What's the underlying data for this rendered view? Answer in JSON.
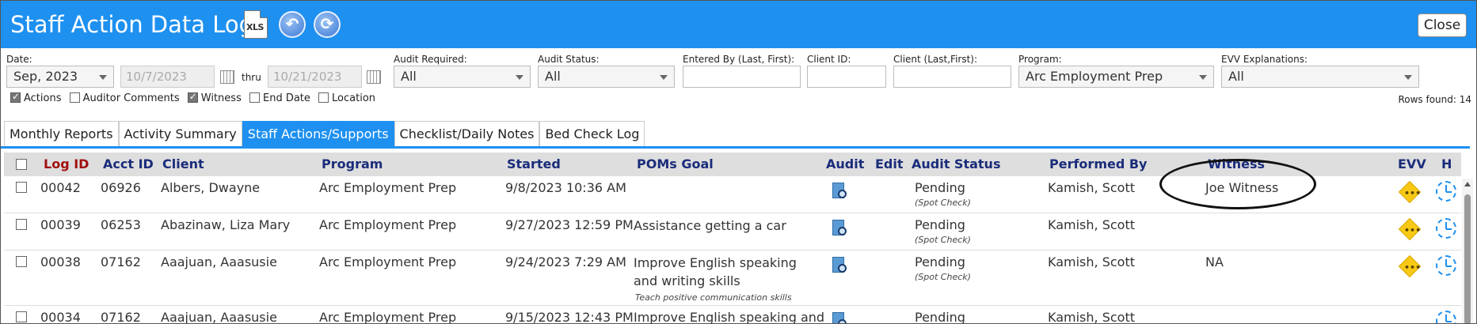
{
  "window": {
    "title": "Staff Action Data Log",
    "xls_label": "XLS",
    "close_label": "Close"
  },
  "filters": {
    "date_label": "Date:",
    "date_value": "Sep, 2023",
    "from_date": "10/7/2023",
    "thru_label": "thru",
    "to_date": "10/21/2023",
    "audit_required_label": "Audit Required:",
    "audit_required_value": "All",
    "audit_status_label": "Audit Status:",
    "audit_status_value": "All",
    "entered_by_label": "Entered By (Last, First):",
    "client_id_label": "Client ID:",
    "client_name_label": "Client (Last,First):",
    "program_label": "Program:",
    "program_value": "Arc Employment Prep",
    "evv_label": "EVV Explanations:",
    "evv_value": "All",
    "rows_found": "Rows found: 14",
    "checkboxes": [
      {
        "label": "Actions",
        "checked": true
      },
      {
        "label": "Auditor Comments",
        "checked": false
      },
      {
        "label": "Witness",
        "checked": true
      },
      {
        "label": "End Date",
        "checked": false
      },
      {
        "label": "Location",
        "checked": false
      }
    ]
  },
  "tabs": [
    {
      "label": "Monthly Reports",
      "active": false
    },
    {
      "label": "Activity Summary",
      "active": false
    },
    {
      "label": "Staff Actions/Supports",
      "active": true
    },
    {
      "label": "Checklist/Daily Notes",
      "active": false
    },
    {
      "label": "Bed Check Log",
      "active": false
    }
  ],
  "table": {
    "headers": {
      "log_id": "Log ID",
      "acct_id": "Acct ID",
      "client": "Client",
      "program": "Program",
      "started": "Started",
      "goal": "POMs Goal",
      "audit": "Audit",
      "edit": "Edit",
      "audit_status": "Audit Status",
      "performed_by": "Performed By",
      "witness": "Witness",
      "evv": "EVV",
      "history": "H"
    },
    "rows": [
      {
        "log_id": "00042",
        "acct_id": "06926",
        "client": "Albers, Dwayne",
        "program": "Arc Employment Prep",
        "started": "9/8/2023 10:36 AM",
        "goal": "",
        "goal_sub": "",
        "status": "Pending",
        "status_sub": "(Spot Check)",
        "performed_by": "Kamish, Scott",
        "witness": "Joe Witness"
      },
      {
        "log_id": "00039",
        "acct_id": "06253",
        "client": "Abazinaw, Liza Mary",
        "program": "Arc Employment Prep",
        "started": "9/27/2023 12:59 PM",
        "goal": "Assistance getting a car",
        "goal_sub": "",
        "status": "Pending",
        "status_sub": "(Spot Check)",
        "performed_by": "Kamish, Scott",
        "witness": ""
      },
      {
        "log_id": "00038",
        "acct_id": "07162",
        "client": "Aaajuan, Aaasusie",
        "program": "Arc Employment Prep",
        "started": "9/24/2023 7:29 AM",
        "goal": "Improve English speaking and writing skills",
        "goal_sub": "Teach positive communication skills",
        "status": "Pending",
        "status_sub": "(Spot Check)",
        "performed_by": "Kamish, Scott",
        "witness": "NA"
      },
      {
        "log_id": "00034",
        "acct_id": "07162",
        "client": "Aaajuan, Aaasusie",
        "program": "Arc Employment Prep",
        "started": "9/15/2023 12:43 PM",
        "goal": "Improve English speaking and",
        "goal_sub": "",
        "status": "Pending",
        "status_sub": "",
        "performed_by": "Kamish, Scott",
        "witness": ""
      }
    ]
  },
  "colors": {
    "accent": "#1e90f0",
    "header_text": "#1a2c7a",
    "sort_header_text": "#a01010",
    "evv_warning": "#f7c915"
  }
}
